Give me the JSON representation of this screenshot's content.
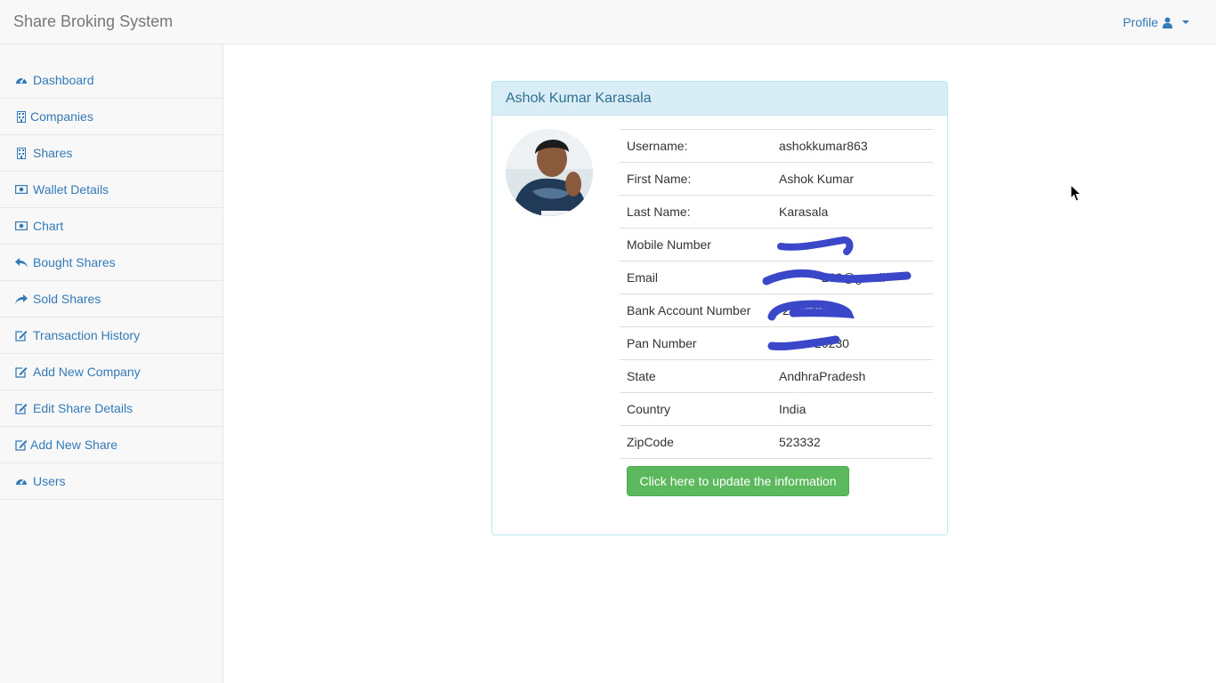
{
  "app": {
    "brand": "Share Broking System",
    "profile_label": "Profile"
  },
  "sidebar": {
    "items": [
      {
        "label": "Dashboard",
        "icon": "dashboard-icon"
      },
      {
        "label": "Companies",
        "icon": "building-icon"
      },
      {
        "label": "Shares",
        "icon": "building-icon"
      },
      {
        "label": "Wallet Details",
        "icon": "money-icon"
      },
      {
        "label": "Chart",
        "icon": "money-icon"
      },
      {
        "label": "Bought Shares",
        "icon": "reply-icon"
      },
      {
        "label": "Sold Shares",
        "icon": "share-icon"
      },
      {
        "label": "Transaction History",
        "icon": "edit-icon"
      },
      {
        "label": "Add New Company",
        "icon": "edit-icon"
      },
      {
        "label": "Edit Share Details",
        "icon": "edit-icon"
      },
      {
        "label": "Add New Share",
        "icon": "edit-icon"
      },
      {
        "label": "Users",
        "icon": "dashboard-icon"
      }
    ]
  },
  "profile": {
    "name": "Ashok Kumar Karasala",
    "rows": [
      {
        "label": "Username:",
        "value": "ashokkumar863"
      },
      {
        "label": "First Name:",
        "value": "Ashok Kumar"
      },
      {
        "label": "Last Name:",
        "value": "Karasala"
      },
      {
        "label": "Mobile Number",
        "value": "",
        "redacted": true
      },
      {
        "label": "Email",
        "value": "263@gmail",
        "redacted": true
      },
      {
        "label": "Bank Account Number",
        "value": "22054330",
        "redacted": true
      },
      {
        "label": "Pan Number",
        "value": "20230",
        "redacted": true
      },
      {
        "label": "State",
        "value": "AndhraPradesh"
      },
      {
        "label": "Country",
        "value": "India"
      },
      {
        "label": "ZipCode",
        "value": "523332"
      }
    ],
    "update_button": "Click here to update the information"
  },
  "colors": {
    "link": "#337ab7",
    "panel_heading_bg": "#d9edf7",
    "button": "#5cb85c",
    "redaction": "#3a47c9"
  }
}
